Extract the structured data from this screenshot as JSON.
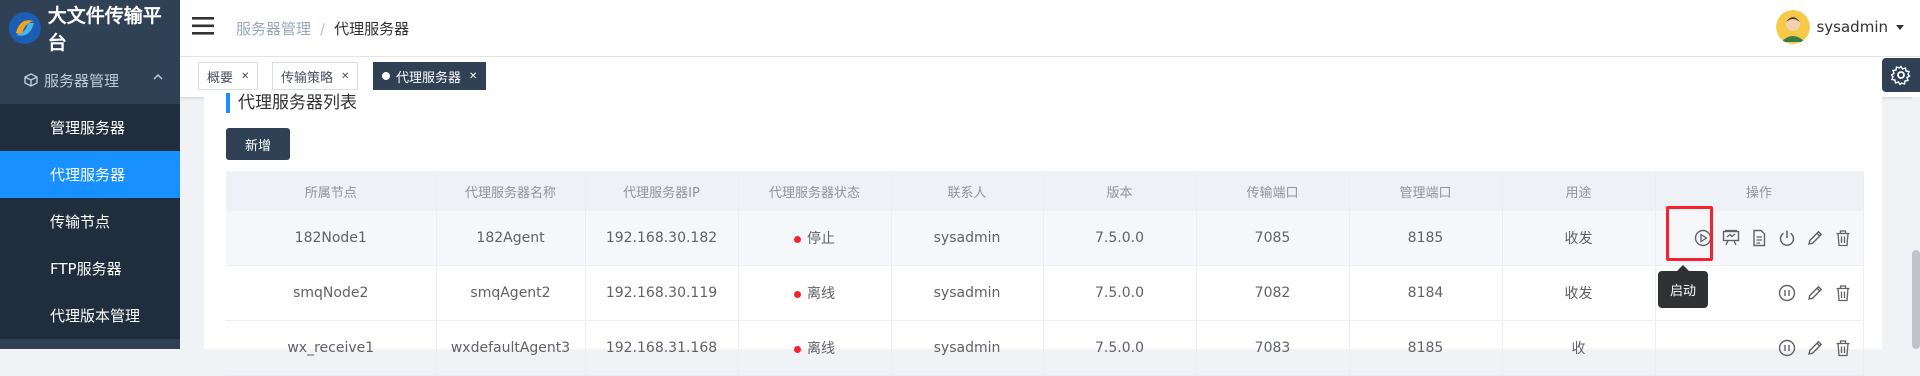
{
  "app": {
    "title": "大文件传输平台"
  },
  "sidebar": {
    "group_label": "服务器管理",
    "items": [
      {
        "label": "管理服务器",
        "active": false
      },
      {
        "label": "代理服务器",
        "active": true
      },
      {
        "label": "传输节点",
        "active": false
      },
      {
        "label": "FTP服务器",
        "active": false
      },
      {
        "label": "代理版本管理",
        "active": false
      }
    ]
  },
  "header": {
    "breadcrumb": {
      "parent": "服务器管理",
      "separator": "/",
      "current": "代理服务器"
    },
    "user": {
      "name": "sysadmin"
    }
  },
  "tags": [
    {
      "label": "概要",
      "active": false
    },
    {
      "label": "传输策略",
      "active": false
    },
    {
      "label": "代理服务器",
      "active": true
    }
  ],
  "main": {
    "title": "代理服务器列表",
    "add_label": "新增",
    "columns": [
      "所属节点",
      "代理服务器名称",
      "代理服务器IP",
      "代理服务器状态",
      "联系人",
      "版本",
      "传输端口",
      "管理端口",
      "用途",
      "操作"
    ],
    "rows": [
      {
        "node": "182Node1",
        "name": "182Agent",
        "ip": "192.168.30.182",
        "status": "停止",
        "contact": "sysadmin",
        "version": "7.5.0.0",
        "transfer_port": "7085",
        "mgmt_port": "8185",
        "usage": "收发"
      },
      {
        "node": "smqNode2",
        "name": "smqAgent2",
        "ip": "192.168.30.119",
        "status": "离线",
        "contact": "sysadmin",
        "version": "7.5.0.0",
        "transfer_port": "7082",
        "mgmt_port": "8184",
        "usage": "收发"
      },
      {
        "node": "wx_receive1",
        "name": "wxdefaultAgent3",
        "ip": "192.168.31.168",
        "status": "离线",
        "contact": "sysadmin",
        "version": "7.5.0.0",
        "transfer_port": "7083",
        "mgmt_port": "8185",
        "usage": "收"
      }
    ],
    "tooltip": "启动"
  },
  "colors": {
    "sidebar_bg": "#304156",
    "active_item": "#1890ff",
    "status_red": "#f5222d",
    "highlight": "#f5222d"
  }
}
